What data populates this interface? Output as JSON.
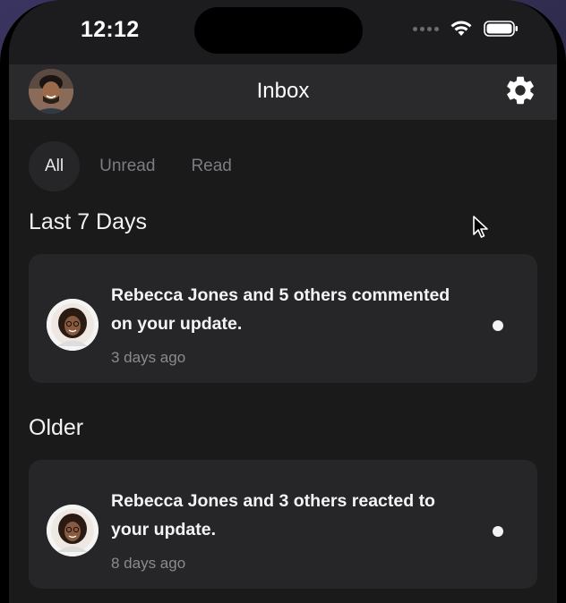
{
  "status_bar": {
    "time": "12:12"
  },
  "header": {
    "title": "Inbox"
  },
  "tabs": [
    {
      "label": "All",
      "active": true
    },
    {
      "label": "Unread",
      "active": false
    },
    {
      "label": "Read",
      "active": false
    }
  ],
  "sections": [
    {
      "title": "Last 7 Days",
      "notifications": [
        {
          "message": "Rebecca Jones and 5 others commented on your update.",
          "age": "3 days ago",
          "unread": true
        }
      ]
    },
    {
      "title": "Older",
      "notifications": [
        {
          "message": "Rebecca Jones and 3 others reacted to your update.",
          "age": "8 days ago",
          "unread": true
        }
      ]
    }
  ],
  "icons": [
    "avatar",
    "gear-icon",
    "wifi-icon",
    "battery-icon",
    "signal-icon",
    "unread-dot",
    "cursor-icon"
  ]
}
